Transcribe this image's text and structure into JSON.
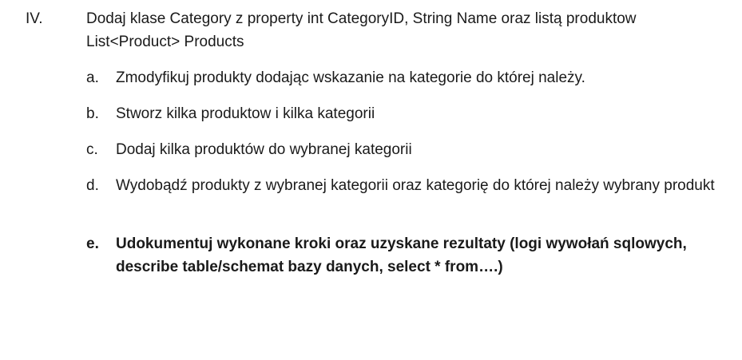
{
  "section": {
    "number": "IV.",
    "text": "Dodaj klase Category z property int CategoryID, String Name oraz listą produktow List<Product> Products"
  },
  "items": [
    {
      "letter": "a.",
      "text": "Zmodyfikuj produkty dodając wskazanie na kategorie do której należy."
    },
    {
      "letter": "b.",
      "text": "Stworz kilka produktow i kilka kategorii"
    },
    {
      "letter": "c.",
      "text": "Dodaj kilka produktów do wybranej kategorii"
    },
    {
      "letter": "d.",
      "text": "Wydobądź produkty z wybranej kategorii oraz kategorię do której należy wybrany produkt"
    },
    {
      "letter": "e.",
      "text": "Udokumentuj wykonane kroki oraz uzyskane rezultaty  (logi wywołań sqlowych, describe table/schemat bazy danych, select * from….)"
    }
  ]
}
